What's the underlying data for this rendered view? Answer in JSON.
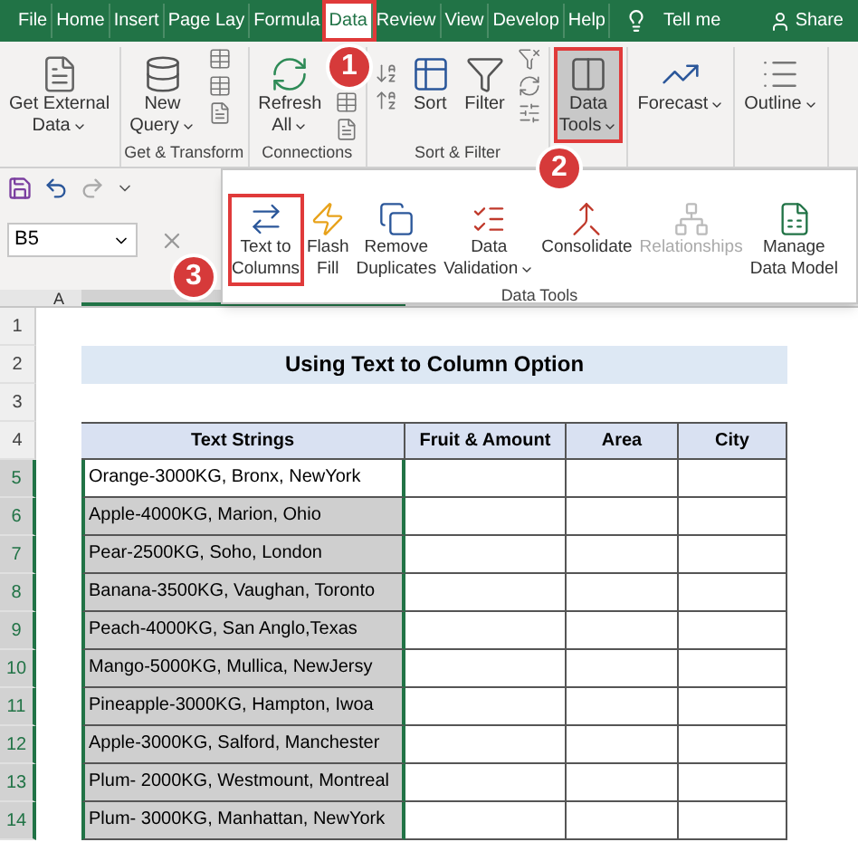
{
  "tabs": [
    {
      "label": "File",
      "selected": false
    },
    {
      "label": "Home",
      "selected": false
    },
    {
      "label": "Insert",
      "selected": false
    },
    {
      "label": "Page Lay",
      "selected": false
    },
    {
      "label": "Formula",
      "selected": false
    },
    {
      "label": "Data",
      "selected": true
    },
    {
      "label": "Review",
      "selected": false
    },
    {
      "label": "View",
      "selected": false
    },
    {
      "label": "Develop",
      "selected": false
    },
    {
      "label": "Help",
      "selected": false
    }
  ],
  "tell_me": "Tell me",
  "share": "Share",
  "ribbon": {
    "groups": [
      {
        "kind": "external",
        "buttons": [
          {
            "kind": "file",
            "lines": [
              "Get External",
              "Data"
            ],
            "dropdown": true,
            "selected": false
          }
        ]
      },
      {
        "kind": "transform",
        "label": "Get & Transform",
        "buttons": [
          {
            "kind": "query",
            "lines": [
              "New",
              "Query"
            ],
            "dropdown": true,
            "selected": false
          }
        ]
      },
      {
        "kind": "connections",
        "label": "Connections",
        "buttons": [
          {
            "kind": "refresh",
            "lines": [
              "Refresh",
              "All"
            ],
            "dropdown": true,
            "selected": false
          }
        ]
      },
      {
        "kind": "sortfilter",
        "label": "Sort & Filter",
        "buttons": [
          {
            "kind": "sort",
            "lines": [
              "Sort"
            ],
            "dropdown": false,
            "selected": false
          },
          {
            "kind": "filter",
            "lines": [
              "Filter"
            ],
            "dropdown": false,
            "selected": false
          }
        ]
      },
      {
        "kind": "datatools",
        "buttons": [
          {
            "kind": "datatools",
            "lines": [
              "Data",
              "Tools"
            ],
            "dropdown": true,
            "selected": true
          }
        ]
      },
      {
        "kind": "forecast",
        "buttons": [
          {
            "kind": "forecast",
            "lines": [
              "Forecast"
            ],
            "dropdown": true,
            "selected": false
          }
        ]
      },
      {
        "kind": "outline",
        "buttons": [
          {
            "kind": "outline",
            "lines": [
              "Outline"
            ],
            "dropdown": true,
            "selected": false
          }
        ]
      }
    ]
  },
  "name_box": "B5",
  "data_tools_panel": {
    "label": "Data Tools",
    "buttons": [
      {
        "kind": "textcols",
        "lines": [
          "Text to",
          "Columns"
        ],
        "dropdown": false,
        "highlighted": true,
        "disabled": false
      },
      {
        "kind": "flash",
        "lines": [
          "Flash",
          "Fill"
        ],
        "dropdown": false,
        "highlighted": false,
        "disabled": false
      },
      {
        "kind": "dupes",
        "lines": [
          "Remove",
          "Duplicates"
        ],
        "dropdown": false,
        "highlighted": false,
        "disabled": false
      },
      {
        "kind": "validation",
        "lines": [
          "Data",
          "Validation"
        ],
        "dropdown": true,
        "highlighted": false,
        "disabled": false
      },
      {
        "kind": "consolidate",
        "lines": [
          "Consolidate"
        ],
        "dropdown": false,
        "highlighted": false,
        "disabled": false
      },
      {
        "kind": "relationships",
        "lines": [
          "Relationships"
        ],
        "dropdown": false,
        "highlighted": false,
        "disabled": true
      },
      {
        "kind": "model",
        "lines": [
          "Manage",
          "Data Model"
        ],
        "dropdown": false,
        "highlighted": false,
        "disabled": false
      }
    ]
  },
  "callouts": [
    "1",
    "2",
    "3"
  ],
  "column_header": "A",
  "row_numbers": [
    {
      "label": "1",
      "selected": false
    },
    {
      "label": "2",
      "selected": false
    },
    {
      "label": "3",
      "selected": false
    },
    {
      "label": "4",
      "selected": false
    },
    {
      "label": "5",
      "selected": true
    },
    {
      "label": "6",
      "selected": true
    },
    {
      "label": "7",
      "selected": true
    },
    {
      "label": "8",
      "selected": true
    },
    {
      "label": "9",
      "selected": true
    },
    {
      "label": "10",
      "selected": true
    },
    {
      "label": "11",
      "selected": true
    },
    {
      "label": "12",
      "selected": true
    },
    {
      "label": "13",
      "selected": true
    },
    {
      "label": "14",
      "selected": true
    }
  ],
  "sheet_title": "Using Text to Column Option",
  "columns": [
    "Text Strings",
    "Fruit & Amount",
    "Area",
    "City"
  ],
  "rows": [
    {
      "text": "Orange-3000KG, Bronx, NewYork",
      "selected": false
    },
    {
      "text": "Apple-4000KG, Marion, Ohio",
      "selected": true
    },
    {
      "text": "Pear-2500KG, Soho, London",
      "selected": true
    },
    {
      "text": "Banana-3500KG, Vaughan, Toronto",
      "selected": true
    },
    {
      "text": "Peach-4000KG, San Anglo,Texas",
      "selected": true
    },
    {
      "text": "Mango-5000KG, Mullica, NewJersy",
      "selected": true
    },
    {
      "text": "Pineapple-3000KG, Hampton, Iwoa",
      "selected": true
    },
    {
      "text": "Apple-3000KG, Salford, Manchester",
      "selected": true
    },
    {
      "text": "Plum- 2000KG, Westmount, Montreal",
      "selected": true
    },
    {
      "text": "Plum- 3000KG, Manhattan, NewYork",
      "selected": true
    }
  ]
}
